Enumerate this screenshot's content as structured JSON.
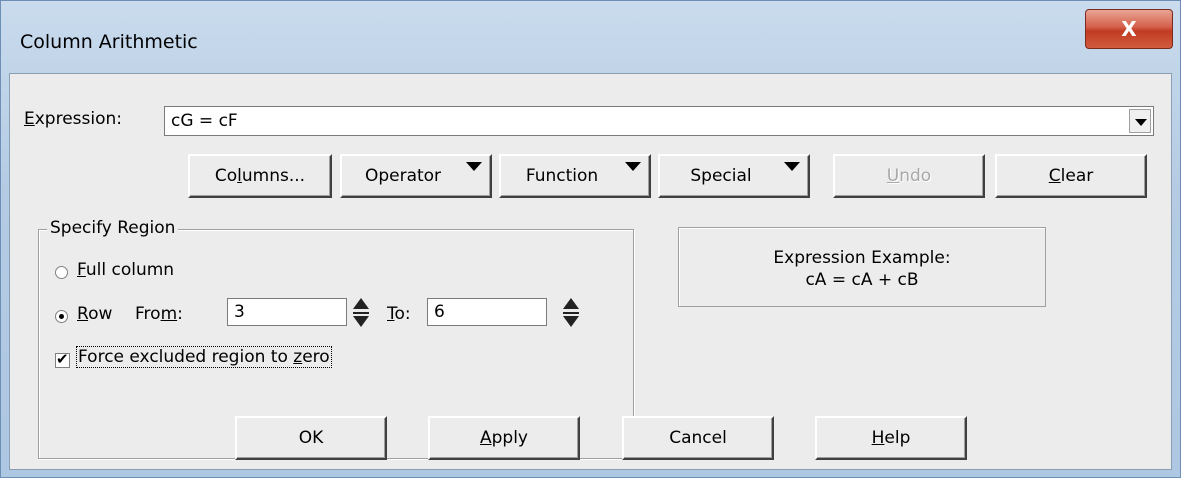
{
  "window": {
    "title": "Column Arithmetic",
    "close_label": "X"
  },
  "expression": {
    "label_ul": "E",
    "label_rest": "xpression:",
    "value": "cG = cF"
  },
  "toolbar": {
    "columns": {
      "pre": "Co",
      "ul": "l",
      "post": "umns..."
    },
    "operator": "Operator",
    "function": "Function",
    "special": "Special",
    "undo": {
      "ul": "U",
      "post": "ndo"
    },
    "clear": {
      "ul": "C",
      "post": "lear"
    }
  },
  "region": {
    "title": "Specify Region",
    "full_column": {
      "ul": "F",
      "post": "ull column",
      "selected": false
    },
    "row": {
      "ul": "R",
      "post": "ow",
      "selected": true
    },
    "from": {
      "pre": "Fro",
      "ul": "m",
      "post": ":",
      "value": "3"
    },
    "to": {
      "ul": "T",
      "post": "o:",
      "value": "6"
    },
    "force_zero": {
      "pre": "Force excluded region to ",
      "ul": "z",
      "post": "ero",
      "checked": true
    }
  },
  "example": {
    "line1": "Expression Example:",
    "line2": "cA = cA + cB"
  },
  "footer": {
    "ok": "OK",
    "apply": {
      "ul": "A",
      "post": "pply"
    },
    "cancel": "Cancel",
    "help": {
      "ul": "H",
      "post": "elp"
    }
  }
}
